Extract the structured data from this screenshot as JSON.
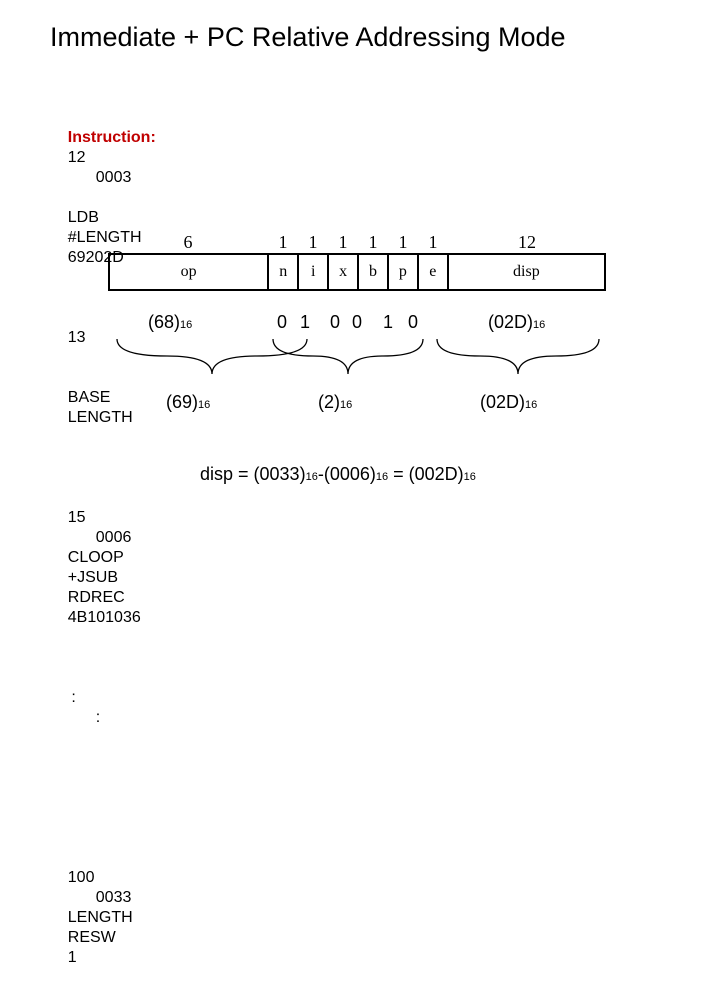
{
  "title": "Immediate + PC Relative Addressing Mode",
  "instruction_label": "Instruction:",
  "rows": [
    {
      "line": "12",
      "loc": "0003",
      "label": "",
      "op": "LDB",
      "arg": "#LENGTH",
      "obj": "69202D"
    },
    {
      "line": "13",
      "loc": "",
      "label": "",
      "op": "BASE",
      "arg": "LENGTH",
      "obj": ""
    },
    {
      "line": "15",
      "loc": "0006",
      "label": "CLOOP",
      "op": "+JSUB",
      "arg": "RDREC",
      "obj": "4B101036"
    },
    {
      "line": ":",
      "loc": ":",
      "label": "",
      "op": "",
      "arg": "",
      "obj": ""
    },
    {
      "line": "100",
      "loc": "0033",
      "label": "LENGTH",
      "op": "RESW",
      "arg": "1",
      "obj": ""
    }
  ],
  "format": {
    "widths": {
      "op": "6",
      "n": "1",
      "i": "1",
      "x": "1",
      "b": "1",
      "p": "1",
      "e": "1",
      "disp": "12"
    },
    "labels": {
      "op": "op",
      "n": "n",
      "i": "i",
      "x": "x",
      "b": "b",
      "p": "p",
      "e": "e",
      "disp": "disp"
    }
  },
  "fill": {
    "opcode_hex": "(68)",
    "opcode_sub": "16",
    "flag_bits": {
      "n": "0",
      "i": "1",
      "x": "0",
      "b": "0",
      "p": "1",
      "e": "0"
    },
    "disp_hex": "(02D)",
    "disp_sub": "16"
  },
  "grouped": {
    "byte1": "(69)",
    "byte1_sub": "16",
    "byte2": "(2)",
    "byte2_sub": "16",
    "byte3": "(02D)",
    "byte3_sub": "16"
  },
  "equation": {
    "lhs": "disp = (0033)",
    "sub_a": "16",
    "mid": "-(0006)",
    "sub_b": "16",
    "eq": " = (002D)",
    "sub_c": "16"
  }
}
